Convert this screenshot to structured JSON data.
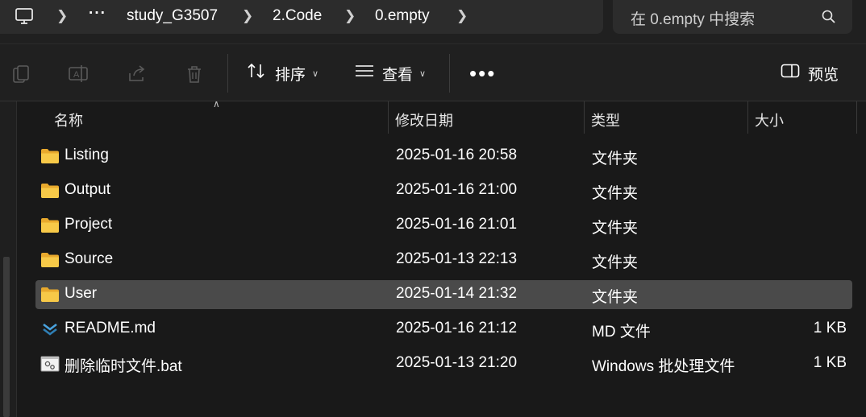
{
  "address_bar": {
    "computer_icon": "computer-icon",
    "overflow": "···",
    "segments": [
      "study_G3507",
      "2.Code",
      "0.empty"
    ]
  },
  "search": {
    "placeholder": "在 0.empty 中搜索",
    "icon": "search-icon"
  },
  "toolbar": {
    "icons": [
      "copy-icon",
      "rename-icon",
      "share-icon",
      "delete-icon"
    ],
    "sort_label": "排序",
    "view_label": "查看",
    "more_label": "•••",
    "preview_label": "预览"
  },
  "columns": {
    "name": "名称",
    "modified": "修改日期",
    "type": "类型",
    "size": "大小"
  },
  "files": [
    {
      "name": "Listing",
      "modified": "2025-01-16 20:58",
      "type": "文件夹",
      "size": "",
      "icon": "folder-icon",
      "selected": false
    },
    {
      "name": "Output",
      "modified": "2025-01-16 21:00",
      "type": "文件夹",
      "size": "",
      "icon": "folder-icon",
      "selected": false
    },
    {
      "name": "Project",
      "modified": "2025-01-16 21:01",
      "type": "文件夹",
      "size": "",
      "icon": "folder-icon",
      "selected": false
    },
    {
      "name": "Source",
      "modified": "2025-01-13 22:13",
      "type": "文件夹",
      "size": "",
      "icon": "folder-icon",
      "selected": false
    },
    {
      "name": "User",
      "modified": "2025-01-14 21:32",
      "type": "文件夹",
      "size": "",
      "icon": "folder-icon",
      "selected": true
    },
    {
      "name": "README.md",
      "modified": "2025-01-16 21:12",
      "type": "MD 文件",
      "size": "1 KB",
      "icon": "markdown-file-icon",
      "selected": false
    },
    {
      "name": "删除临时文件.bat",
      "modified": "2025-01-13 21:20",
      "type": "Windows 批处理文件",
      "size": "1 KB",
      "icon": "batch-file-icon",
      "selected": false
    }
  ],
  "colors": {
    "background": "#191919",
    "selection": "#4a4a4a",
    "folder": "#f4c542",
    "markdown_accent": "#4aa3df"
  }
}
